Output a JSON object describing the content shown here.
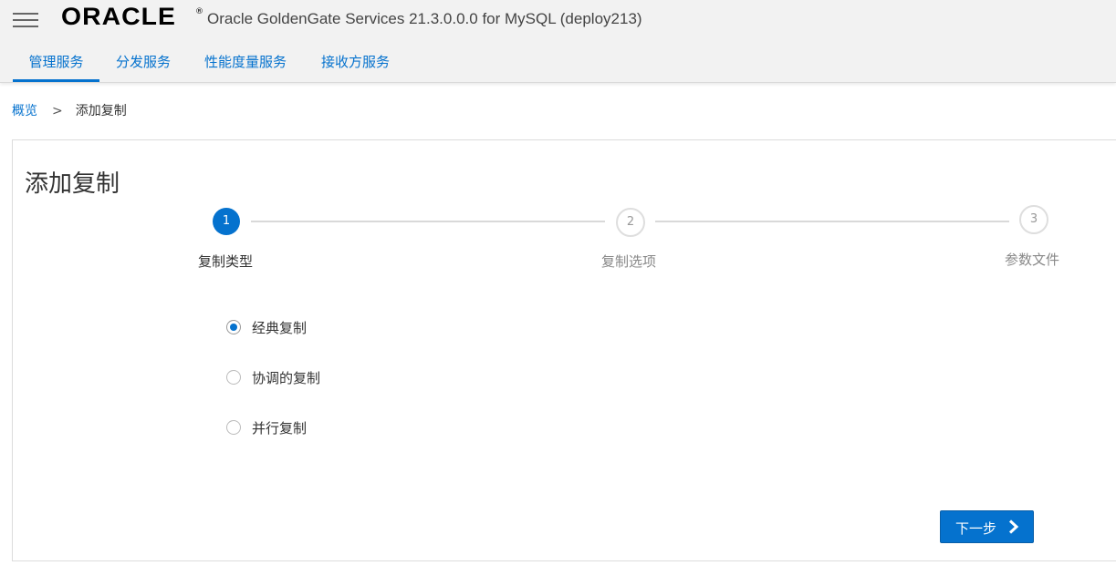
{
  "header": {
    "logo_text": "ORACLE",
    "logo_reg": "®",
    "app_title": "Oracle GoldenGate Services 21.3.0.0.0 for MySQL (deploy213)",
    "tabs": [
      {
        "label": "管理服务",
        "active": true
      },
      {
        "label": "分发服务",
        "active": false
      },
      {
        "label": "性能度量服务",
        "active": false
      },
      {
        "label": "接收方服务",
        "active": false
      }
    ]
  },
  "breadcrumb": {
    "parent": "概览",
    "separator": ">",
    "current": "添加复制"
  },
  "panel": {
    "title": "添加复制",
    "steps": [
      {
        "number": "1",
        "label": "复制类型",
        "active": true
      },
      {
        "number": "2",
        "label": "复制选项",
        "active": false
      },
      {
        "number": "3",
        "label": "参数文件",
        "active": false
      }
    ],
    "options": [
      {
        "label": "经典复制",
        "checked": true
      },
      {
        "label": "协调的复制",
        "checked": false
      },
      {
        "label": "并行复制",
        "checked": false
      }
    ],
    "next_label": "下一步"
  },
  "colors": {
    "accent": "#0572ce",
    "header_bg": "#f2f2f2",
    "inactive_step": "#dedede"
  },
  "icons": {
    "menu": "hamburger-menu-icon",
    "next": "chevron-right-icon"
  }
}
